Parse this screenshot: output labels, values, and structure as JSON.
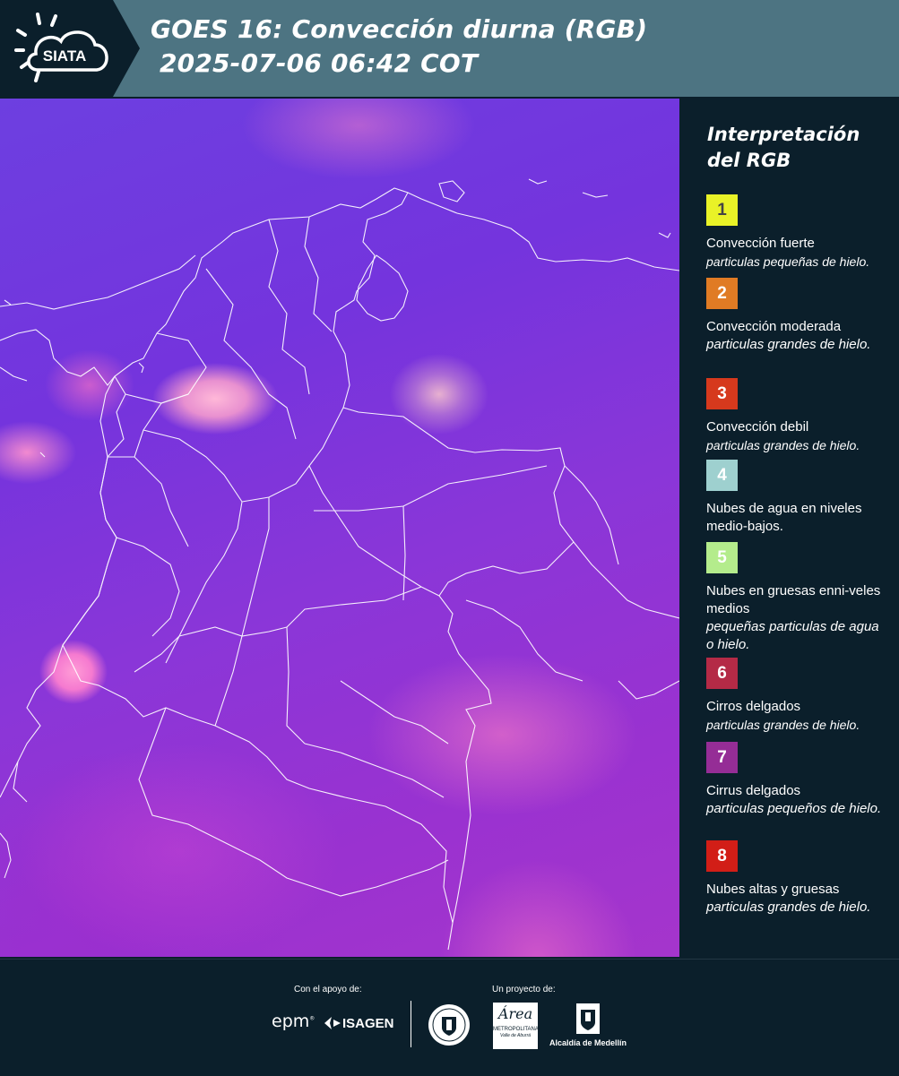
{
  "header": {
    "logo_text": "SIATA",
    "title_line1": "GOES 16: Convección diurna (RGB)",
    "title_line2": " 2025-07-06 06:42 COT"
  },
  "legend": {
    "title_line1": "Interpretación",
    "title_line2": "del RGB",
    "items": [
      {
        "number": "1",
        "color": "#e9f227",
        "text_color": "#444444",
        "name": "Convección fuerte",
        "desc": "particulas pequeñas de hielo."
      },
      {
        "number": "2",
        "color": "#e07b24",
        "text_color": "#ffffff",
        "name": "Convección moderada",
        "desc": "particulas grandes de hielo."
      },
      {
        "number": "3",
        "color": "#d6391d",
        "text_color": "#ffffff",
        "name": "Convección debil",
        "desc": "particulas grandes de hielo."
      },
      {
        "number": "4",
        "color": "#9ed0cf",
        "text_color": "#ffffff",
        "name": "Nubes de agua en niveles medio-bajos.",
        "desc": ""
      },
      {
        "number": "5",
        "color": "#b4ec8c",
        "text_color": "#ffffff",
        "name": "Nubes en gruesas enni-veles medios",
        "desc": "pequeñas particulas de agua o hielo."
      },
      {
        "number": "6",
        "color": "#b42a46",
        "text_color": "#ffffff",
        "name": "Cirros delgados",
        "desc": "particulas grandes de hielo."
      },
      {
        "number": "7",
        "color": "#952d96",
        "text_color": "#ffffff",
        "name": "Cirrus delgados",
        "desc": "particulas pequeños de hielo."
      },
      {
        "number": "8",
        "color": "#d21e17",
        "text_color": "#ffffff",
        "name": "Nubes altas y gruesas",
        "desc": "particulas grandes de hielo."
      }
    ]
  },
  "footer": {
    "support_label": "Con el apoyo de:",
    "project_label": "Un proyecto de:",
    "epm": "epm",
    "isagen": "ISAGEN",
    "area_name": "Área",
    "area_sub1": "METROPOLITANA",
    "area_sub2": "Valle de Aburrá",
    "alcaldia": "Alcaldía de Medellín"
  },
  "colors": {
    "header_bg": "#4d7482",
    "logo_bg": "#0b1f2b",
    "panel_bg": "#0b1f2b"
  }
}
